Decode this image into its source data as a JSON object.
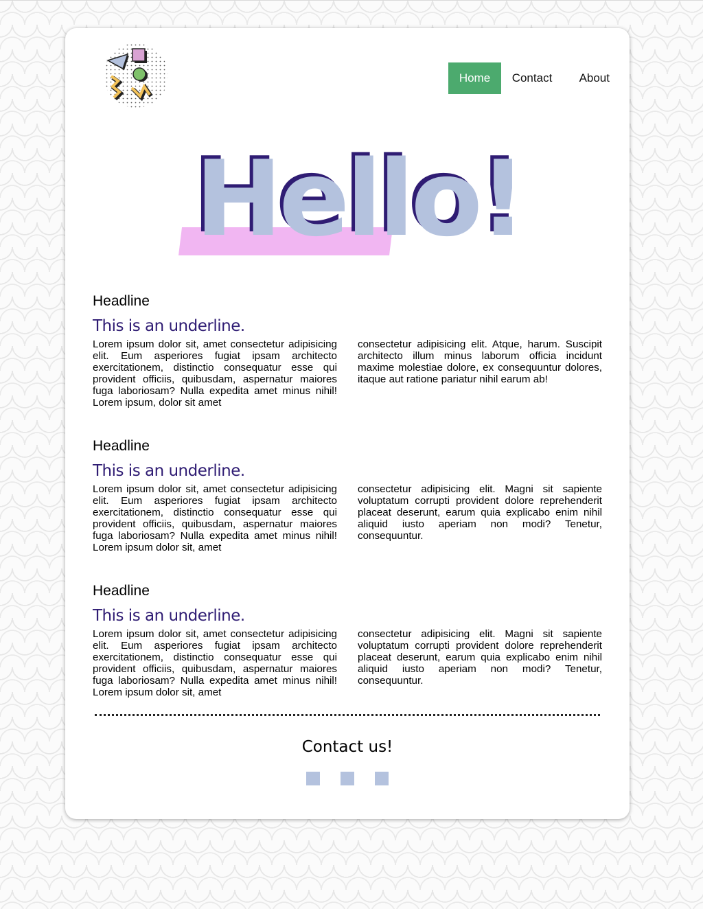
{
  "nav": {
    "items": [
      "Home",
      "Contact",
      "About"
    ],
    "active": "Home"
  },
  "hero": {
    "text": "Hello!"
  },
  "sections": [
    {
      "headline": "Headline",
      "underline": "This is an underline.",
      "left_text": "Lorem ipsum dolor sit, amet consectetur adipisicing elit. Eum asperiores fugiat ipsam architecto exercitationem, distinctio consequatur esse qui provident officiis, quibusdam, aspernatur maiores fuga laboriosam? Nulla expedita amet minus nihil! Lorem ipsum, dolor sit amet",
      "right_text": "consectetur adipisicing elit. Atque, harum. Suscipit architecto illum minus laborum officia incidunt maxime molestiae dolore, ex consequuntur dolores, itaque aut ratione pariatur nihil earum ab!"
    },
    {
      "headline": "Headline",
      "underline": "This is an underline.",
      "left_text": "Lorem ipsum dolor sit, amet consectetur adipisicing elit. Eum asperiores fugiat ipsam architecto exercitationem, distinctio consequatur esse qui provident officiis, quibusdam, aspernatur maiores fuga laboriosam? Nulla expedita amet minus nihil! Lorem ipsum dolor sit, amet",
      "right_text": "consectetur adipisicing elit. Magni sit sapiente voluptatum corrupti provident dolore reprehenderit placeat deserunt, earum quia explicabo enim nihil aliquid iusto aperiam non modi? Tenetur, consequuntur."
    },
    {
      "headline": "Headline",
      "underline": "This is an underline.",
      "left_text": "Lorem ipsum dolor sit, amet consectetur adipisicing elit. Eum asperiores fugiat ipsam architecto exercitationem, distinctio consequatur esse qui provident officiis, quibusdam, aspernatur maiores fuga laboriosam? Nulla expedita amet minus nihil! Lorem ipsum dolor sit, amet",
      "right_text": "consectetur adipisicing elit. Magni sit sapiente voluptatum corrupti provident dolore reprehenderit placeat deserunt, earum quia explicabo enim nihil aliquid iusto aperiam non modi? Tenetur, consequuntur."
    }
  ],
  "footer": {
    "title": "Contact us!",
    "social_icons": [
      "social-icon-1",
      "social-icon-2",
      "social-icon-3"
    ]
  },
  "colors": {
    "nav_active_bg": "#4caa6e",
    "hero_fill": "#b4c2de",
    "hero_shadow": "#2f1c73",
    "hero_band": "#f1b6f2",
    "underline_text": "#2f1c73",
    "social_icon": "#b4c2de"
  }
}
